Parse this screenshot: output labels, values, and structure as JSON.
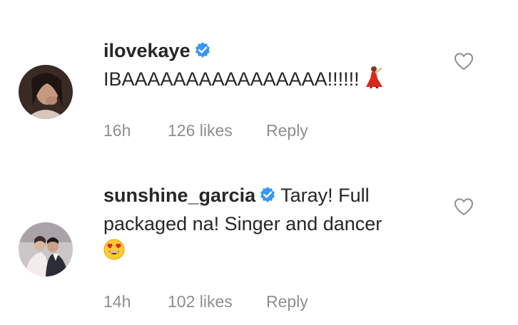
{
  "comments": [
    {
      "username": "ilovekaye",
      "verified": true,
      "text": "IBAAAAAAAAAAAAAAAA!!!!!!",
      "emoji": "dancer-emoji",
      "time": "16h",
      "likes": "126 likes",
      "reply": "Reply"
    },
    {
      "username": "sunshine_garcia",
      "verified": true,
      "text_line1": "Taray! Full",
      "text_line2": "packaged na! Singer and dancer",
      "emoji": "heart-eyes-emoji",
      "time": "14h",
      "likes": "102 likes",
      "reply": "Reply"
    }
  ],
  "icons": {
    "verified_color": "#3897f0",
    "heart_color": "#8e8e8e"
  }
}
